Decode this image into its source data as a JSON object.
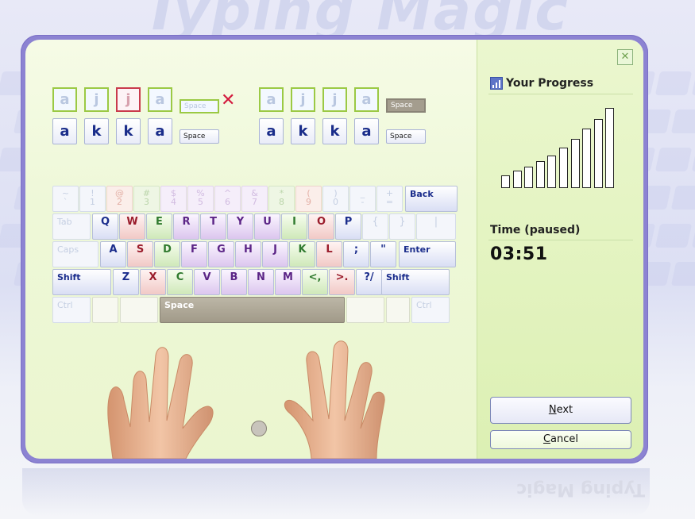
{
  "background": {
    "title": "Typing Magic"
  },
  "practice": {
    "mistake_icon": "red-x-icon",
    "groups": [
      {
        "expected": [
          "a",
          "k",
          "k",
          "a",
          "Space"
        ],
        "typed": [
          "a",
          "j",
          "j",
          "a",
          "Space"
        ],
        "error_index": 2,
        "has_error": true
      },
      {
        "expected": [
          "a",
          "k",
          "k",
          "a",
          "Space"
        ],
        "typed": [
          "a",
          "j",
          "j",
          "a",
          "Space"
        ],
        "error_index": -1,
        "has_error": false
      }
    ]
  },
  "keyboard": {
    "row1": [
      {
        "top": "~",
        "bottom": "`"
      },
      {
        "top": "!",
        "bottom": "1"
      },
      {
        "top": "@",
        "bottom": "2"
      },
      {
        "top": "#",
        "bottom": "3"
      },
      {
        "top": "$",
        "bottom": "4"
      },
      {
        "top": "%",
        "bottom": "5"
      },
      {
        "top": "^",
        "bottom": "6"
      },
      {
        "top": "&",
        "bottom": "7"
      },
      {
        "top": "*",
        "bottom": "8"
      },
      {
        "top": "(",
        "bottom": "9"
      },
      {
        "top": ")",
        "bottom": "0"
      },
      {
        "top": "_",
        "bottom": "-"
      },
      {
        "top": "+",
        "bottom": "="
      },
      {
        "label": "Back"
      }
    ],
    "row2": [
      "Tab",
      "Q",
      "W",
      "E",
      "R",
      "T",
      "Y",
      "U",
      "I",
      "O",
      "P",
      "{",
      "}",
      "|"
    ],
    "row3": [
      "Caps",
      "A",
      "S",
      "D",
      "F",
      "G",
      "H",
      "J",
      "K",
      "L",
      ";",
      "\"",
      "Enter"
    ],
    "row4": [
      "Shift",
      "Z",
      "X",
      "C",
      "V",
      "B",
      "N",
      "M",
      "<,",
      ">.",
      "?/",
      "Shift"
    ],
    "row5": [
      "Ctrl",
      "",
      "",
      "Space",
      "",
      "Ctrl"
    ]
  },
  "sidebar": {
    "close_icon": "close-icon",
    "progress_icon": "bar-chart-icon",
    "progress_title": "Your Progress",
    "progress_levels": [
      0.16,
      0.22,
      0.27,
      0.34,
      0.41,
      0.5,
      0.61,
      0.74,
      0.86,
      1.0
    ],
    "time_label": "Time (paused)",
    "time_value": "03:51",
    "next_label": "Next",
    "next_accel": "N",
    "cancel_label": "Cancel",
    "cancel_accel": "C"
  },
  "colors": {
    "frame": "#8c83d2",
    "panel": "#eef8d8",
    "error": "#d3193d",
    "correct": "#9bc944"
  }
}
